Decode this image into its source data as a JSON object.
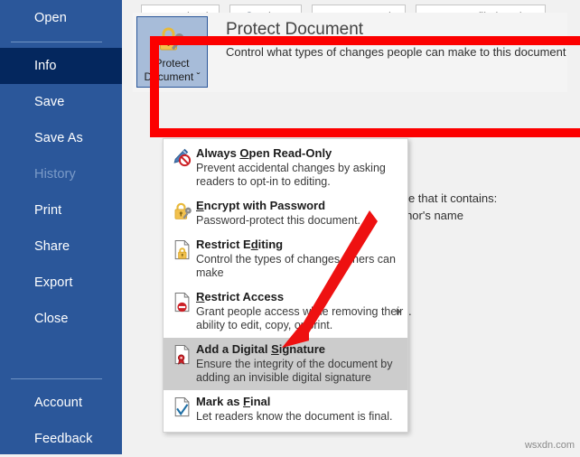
{
  "sidebar": {
    "items": [
      {
        "label": "Open",
        "state": "normal",
        "name": "open"
      },
      {
        "label": "Info",
        "state": "selected",
        "name": "info"
      },
      {
        "label": "Save",
        "state": "normal",
        "name": "save"
      },
      {
        "label": "Save As",
        "state": "normal",
        "name": "save-as"
      },
      {
        "label": "History",
        "state": "disabled",
        "name": "history"
      },
      {
        "label": "Print",
        "state": "normal",
        "name": "print"
      },
      {
        "label": "Share",
        "state": "normal",
        "name": "share"
      },
      {
        "label": "Export",
        "state": "normal",
        "name": "export"
      },
      {
        "label": "Close",
        "state": "normal",
        "name": "close"
      },
      {
        "label": "Account",
        "state": "normal",
        "name": "account"
      },
      {
        "label": "Feedback",
        "state": "normal",
        "name": "feedback"
      }
    ]
  },
  "toolbar": {
    "buttons": [
      {
        "label": "Upload",
        "icon": "cloud-upload-icon"
      },
      {
        "label": "Share",
        "icon": "share-arrow-icon"
      },
      {
        "label": "Copy path",
        "icon": "link-icon"
      },
      {
        "label": "Open file location",
        "icon": "folder-icon"
      }
    ]
  },
  "protect": {
    "button_label_line1": "Protect",
    "button_label_line2": "Document",
    "button_chevron": "ˇ",
    "button_icon": "lock-key-icon",
    "title": "Protect Document",
    "description": "Control what types of changes people can make to this document"
  },
  "background_text": {
    "line1": "ware that it contains:",
    "line2": "author's name",
    "line3": "ges."
  },
  "menu": {
    "items": [
      {
        "icon": "pen-blocked-icon",
        "title_pre": "Always ",
        "title_accel": "O",
        "title_post": "pen Read-Only",
        "desc": "Prevent accidental changes by asking readers to opt-in to editing.",
        "submenu": false,
        "highlighted": false,
        "name": "always-open-read-only"
      },
      {
        "icon": "padlock-key-icon",
        "title_pre": "",
        "title_accel": "E",
        "title_post": "ncrypt with Password",
        "desc": "Password-protect this document.",
        "submenu": false,
        "highlighted": false,
        "name": "encrypt-with-password"
      },
      {
        "icon": "document-lock-icon",
        "title_pre": "Restrict E",
        "title_accel": "d",
        "title_post": "iting",
        "desc": "Control the types of changes others can make",
        "submenu": false,
        "highlighted": false,
        "name": "restrict-editing"
      },
      {
        "icon": "document-deny-icon",
        "title_pre": "",
        "title_accel": "R",
        "title_post": "estrict Access",
        "desc": "Grant people access while removing their ability to edit, copy, or print.",
        "submenu": true,
        "highlighted": false,
        "name": "restrict-access"
      },
      {
        "icon": "document-signature-icon",
        "title_pre": "Add a Digital ",
        "title_accel": "S",
        "title_post": "ignature",
        "desc": "Ensure the integrity of the document by adding an invisible digital signature",
        "submenu": false,
        "highlighted": true,
        "name": "add-a-digital-signature"
      },
      {
        "icon": "document-check-icon",
        "title_pre": "Mark as ",
        "title_accel": "F",
        "title_post": "inal",
        "desc": "Let readers know the document is final.",
        "submenu": false,
        "highlighted": false,
        "name": "mark-as-final"
      }
    ]
  },
  "annotations": {
    "box_color": "#fc0000",
    "arrow_color": "#ee1111"
  },
  "watermark": "wsxdn.com"
}
